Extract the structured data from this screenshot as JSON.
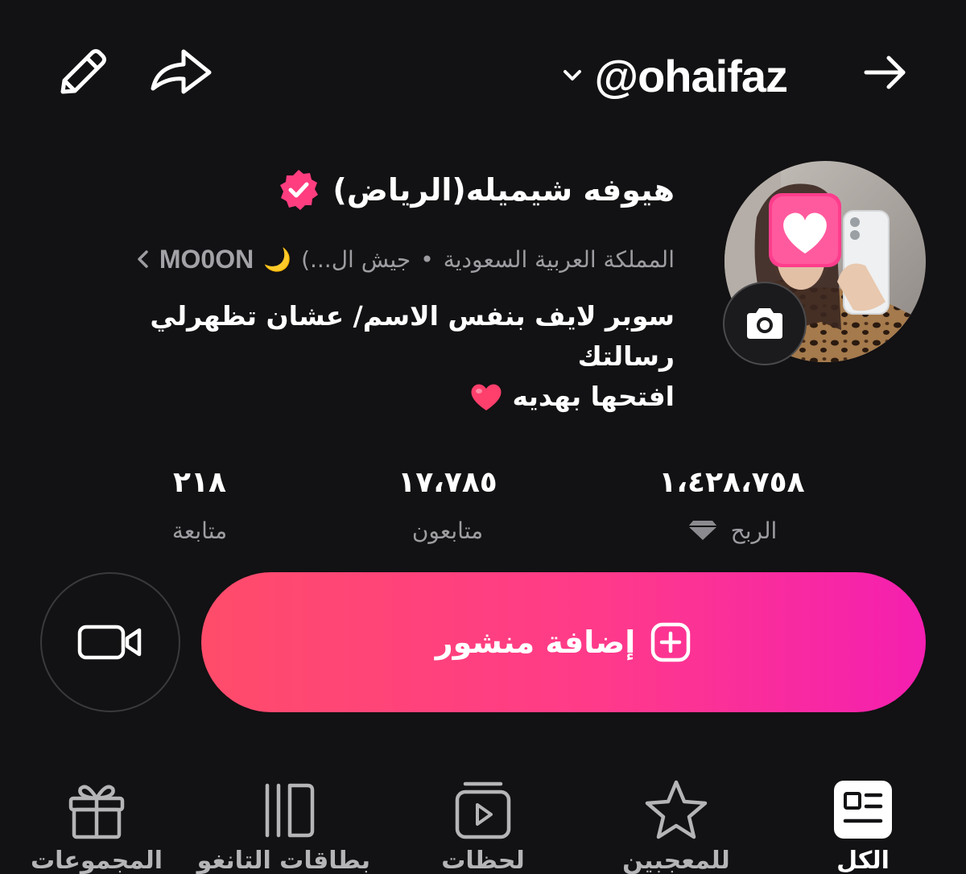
{
  "header": {
    "username": "@ohaifaz",
    "icons": {
      "edit": "pencil-icon",
      "share": "share-arrow-icon",
      "back": "arrow-right-icon",
      "dropdown": "chevron-down-icon"
    }
  },
  "profile": {
    "display_name": "هيوفه شيميله(الرياض)",
    "country": "المملكة العربية السعودية",
    "separator": "•",
    "group": "جيش ال...)",
    "group_emoji": "🌙",
    "group_tag": "MO0ON",
    "bio_line1": "سوبر لايف بنفس الاسم/ عشان تظهرلي رسالتك",
    "bio_line2": "افتحها بهديه",
    "bio_emoji": "❤️",
    "verified_color": "#ff3d7f",
    "heart_sticker": "heart-sticker-icon",
    "camera_icon": "camera-icon"
  },
  "stats": {
    "earnings_value": "١،٤٢٨،٧٥٨",
    "earnings_label": "الربح",
    "followers_value": "١٧،٧٨٥",
    "followers_label": "متابعون",
    "following_value": "٢١٨",
    "following_label": "متابعة"
  },
  "actions": {
    "add_post_label": "إضافة منشور",
    "accent_start": "#ff4c6a",
    "accent_end": "#f41fb0"
  },
  "tabs": [
    {
      "label": "الكل",
      "icon": "news-card-icon",
      "active": true
    },
    {
      "label": "للمعجبين",
      "icon": "star-icon",
      "active": false
    },
    {
      "label": "لحظات",
      "icon": "play-stack-icon",
      "active": false
    },
    {
      "label": "بطاقات التانغو",
      "icon": "cards-icon",
      "active": false
    },
    {
      "label": "المجموعات",
      "icon": "gift-icon",
      "active": false
    }
  ]
}
